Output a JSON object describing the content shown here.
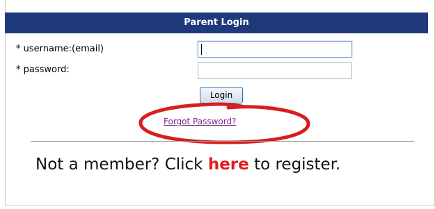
{
  "header": {
    "title": "Parent Login"
  },
  "form": {
    "username_label": "* username:(email)",
    "username_value": "",
    "password_label": "* password:",
    "password_value": "",
    "login_button": "Login",
    "forgot_link": "Forgot Password?"
  },
  "register": {
    "prefix": "Not a member? Click",
    "link": "here",
    "suffix": "to register."
  },
  "colors": {
    "header_bg": "#1e3a7b",
    "highlight_ellipse": "#d81e1e",
    "here_link": "#e01c1c",
    "forgot_link": "#7a2a8c"
  }
}
